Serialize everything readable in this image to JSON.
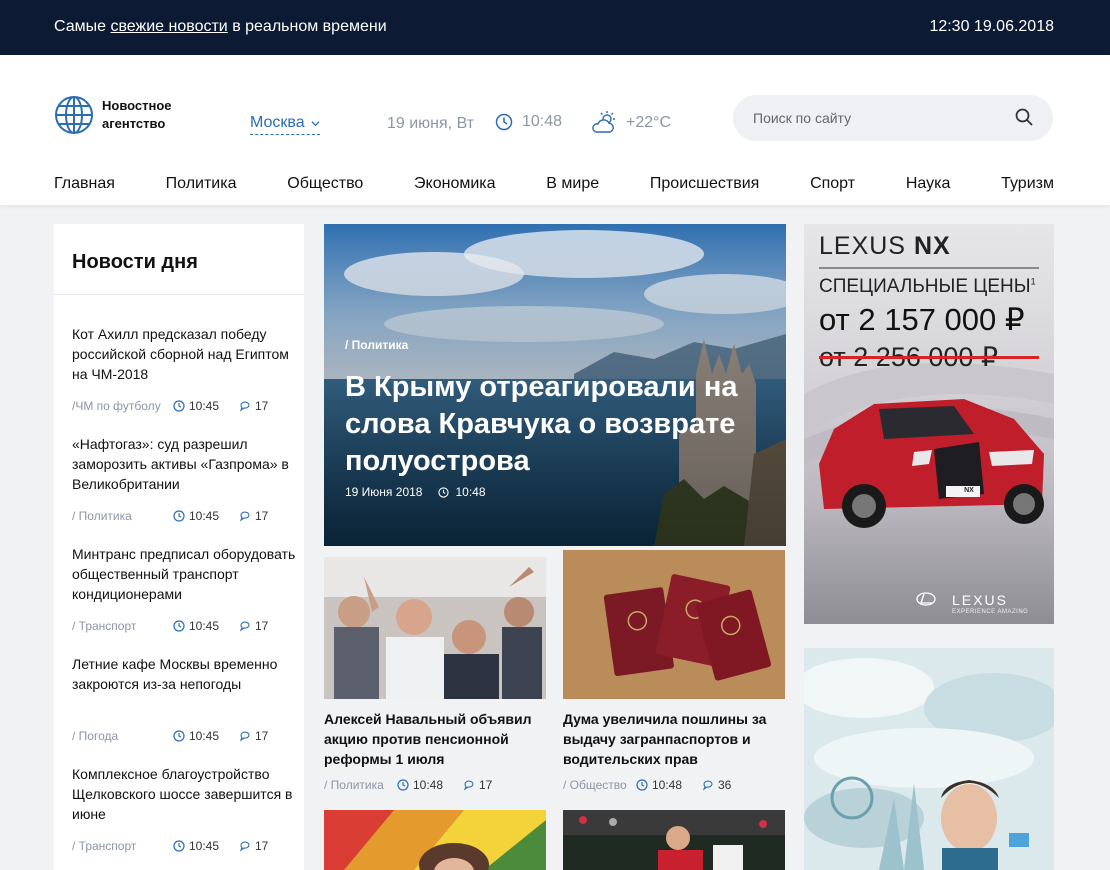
{
  "topbar": {
    "tagline_before": "Самые",
    "tagline_link": "свежие новости",
    "tagline_after": "в реальном времени",
    "datetime": "12:30 19.06.2018"
  },
  "header": {
    "logo_text": "Новостное агентство",
    "city": "Москва",
    "date": "19 июня, Вт",
    "time": "10:48",
    "weather": "+22°C",
    "search_placeholder": "Поиск по сайту"
  },
  "nav": [
    "Главная",
    "Политика",
    "Общество",
    "Экономика",
    "В мире",
    "Происшествия",
    "Спорт",
    "Наука",
    "Туризм"
  ],
  "day_news": {
    "heading": "Новости дня",
    "items": [
      {
        "title": "Кот Ахилл предсказал победу российской сборной над Египтом на ЧМ-2018",
        "category": "/ЧМ по футболу",
        "time": "10:45",
        "comments": "17"
      },
      {
        "title": "«Нафтогаз»: суд разрешил заморозить активы «Газпрома» в Великобритании",
        "category": "/ Политика",
        "time": "10:45",
        "comments": "17"
      },
      {
        "title": "Минтранс предписал оборудовать общественный транспорт кондиционерами",
        "category": "/ Транспорт",
        "time": "10:45",
        "comments": "17"
      },
      {
        "title": "Летние кафе Москвы временно закроются из-за непогоды",
        "category": "/ Погода",
        "time": "10:45",
        "comments": "17"
      },
      {
        "title": "Комплексное благоустройство Щелковского шоссе завершится в июне",
        "category": "/ Транспорт",
        "time": "10:45",
        "comments": "17"
      }
    ]
  },
  "hero": {
    "category": "/ Политика",
    "title": "В Крыму отреагировали на слова Кравчука о возврате полуострова",
    "date": "19 Июня 2018",
    "time": "10:48"
  },
  "cards": [
    {
      "title": "Алексей Навальный объявил акцию против пенсионной реформы 1 июля",
      "category": "/ Политика",
      "time": "10:48",
      "comments": "17"
    },
    {
      "title": "Дума увеличила пошлины за выдачу загранпаспортов и водительских прав",
      "category": "/ Общество",
      "time": "10:48",
      "comments": "36"
    }
  ],
  "ad_lexus": {
    "brand_line_1": "LEXUS",
    "brand_line_2": "NX",
    "offer": "СПЕЦИАЛЬНЫЕ ЦЕНЫ",
    "footnote": "1",
    "price_new": "от 2 157 000 ₽",
    "price_old": "от 2 256 000 ₽",
    "plate": "NX",
    "logo": "LEXUS",
    "slogan": "EXPERIENCE AMAZING"
  },
  "colors": {
    "topbar": "#0c1a33",
    "accent": "#2a6db3",
    "muted": "#8c96a6",
    "ad_red": "#d4242a"
  }
}
